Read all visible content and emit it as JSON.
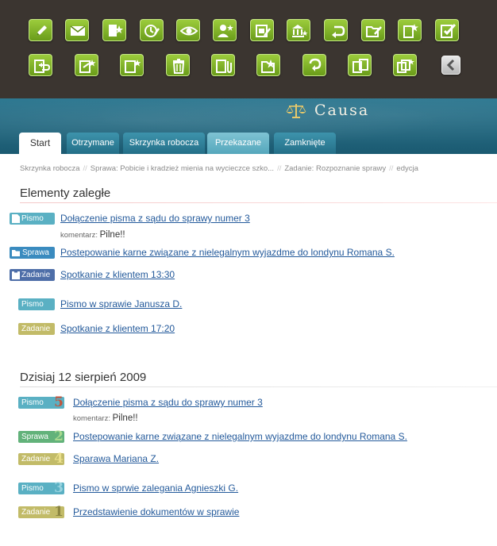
{
  "app": {
    "name": "Causa"
  },
  "toolbar": {
    "row1": [
      "edit-icon",
      "mail-icon",
      "document-star-icon",
      "clipboard-edit-icon",
      "eye-icon",
      "user-star-icon",
      "calendar-edit-icon",
      "bank-star-icon",
      "undo-icon",
      "folder-edit-icon",
      "document-star-icon",
      "document-check-icon"
    ],
    "row2": [
      "document-return-icon",
      "document-star-icon",
      "document-star-icon",
      "trash-icon",
      "paperclip-icon",
      "folder-star-icon",
      "redo-icon",
      "documents-icon",
      "documents-star-icon",
      "collapse-left-icon"
    ]
  },
  "tabs": [
    "Start",
    "Otrzymane",
    "Skrzynka robocza",
    "Przekazane",
    "Zamknięte"
  ],
  "breadcrumb": [
    "Skrzynka robocza",
    "Sprawa: Pobicie i kradzież mienia na wycieczce szko...",
    "Zadanie: Rozpoznanie sprawy",
    "edycja"
  ],
  "overdue": {
    "title": "Elementy zaległe",
    "items": [
      {
        "badge": "Pismo",
        "text": "Dołączenie pisma z sądu do sprawy numer 3",
        "comment_label": "komentarz:",
        "comment": "Pilne!!"
      },
      {
        "badge": "Sprawa",
        "text": "Postepowanie karne związane z nielegalnym wyjazdme do londynu Romana S."
      },
      {
        "badge": "Zadanie",
        "text": "Spotkanie z klientem 13:30"
      },
      {
        "badge": "Pismo",
        "text": "Pismo w sprawie Janusza D."
      },
      {
        "badge": "Zadanie",
        "text": "Spotkanie z klientem 17:20"
      }
    ]
  },
  "today": {
    "title": "Dzisiaj 12 sierpień 2009",
    "items": [
      {
        "badge": "Pismo",
        "number": "5",
        "text": "Dołączenie pisma z sądu do sprawy numer 3",
        "comment_label": "komentarz:",
        "comment": "Pilne!!"
      },
      {
        "badge": "Sprawa",
        "number": "2",
        "text": "Postepowanie karne związane z nielegalnym wyjazdme do londynu Romana S."
      },
      {
        "badge": "Zadanie",
        "number": "4",
        "text": "Sparawa Mariana Z."
      },
      {
        "badge": "Pismo",
        "number": "3",
        "text": "Pismo w sprwie zalegania Agnieszki G."
      },
      {
        "badge": "Zadanie",
        "number": "1",
        "text": "Przedstawienie dokumentów w sprawie"
      }
    ]
  }
}
